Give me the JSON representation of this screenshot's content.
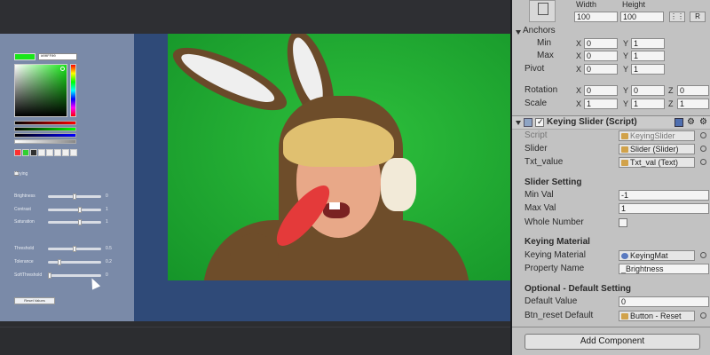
{
  "game_ui": {
    "color_hex": "#00FF00",
    "toggle_label": "Keying",
    "sliders": [
      {
        "name": "Brightness",
        "value": "0",
        "fraction": 0.5
      },
      {
        "name": "Contrast",
        "value": "1",
        "fraction": 0.6
      },
      {
        "name": "Saturation",
        "value": "1",
        "fraction": 0.6
      },
      {
        "name": "Threshold",
        "value": "0.5",
        "fraction": 0.5
      },
      {
        "name": "Tolerance",
        "value": "0.2",
        "fraction": 0.2
      },
      {
        "name": "SoftThreshold",
        "value": "0",
        "fraction": 0.0
      }
    ],
    "reset_label": "Reset Values",
    "preset_colors": [
      "#ff3030",
      "#30d030",
      "#303030",
      "#f0f0f0",
      "#f0f0f0",
      "#f0f0f0",
      "#f0f0f0",
      "#f0f0f0"
    ]
  },
  "inspector": {
    "width_label": "Width",
    "height_label": "Height",
    "width_value": "100",
    "height_value": "100",
    "btn_r": "R",
    "anchors_label": "Anchors",
    "min_label": "Min",
    "max_label": "Max",
    "pivot_label": "Pivot",
    "rotation_label": "Rotation",
    "scale_label": "Scale",
    "anchor_min": {
      "x": "0",
      "y": "1"
    },
    "anchor_max": {
      "x": "0",
      "y": "1"
    },
    "pivot": {
      "x": "0",
      "y": "1"
    },
    "rotation": {
      "x": "0",
      "y": "0",
      "z": "0"
    },
    "scale": {
      "x": "1",
      "y": "1",
      "z": "1"
    },
    "axis_x": "X",
    "axis_y": "Y",
    "axis_z": "Z",
    "component_title": "Keying Slider (Script)",
    "script_label": "Script",
    "script_value": "KeyingSlider",
    "slider_label": "Slider",
    "slider_value": "Slider (Slider)",
    "txt_label": "Txt_value",
    "txt_value": "Txt_val (Text)",
    "slider_setting_header": "Slider Setting",
    "min_val_label": "Min Val",
    "min_val": "-1",
    "max_val_label": "Max Val",
    "max_val": "1",
    "whole_number_label": "Whole Number",
    "keying_material_header": "Keying Material",
    "keying_material_label": "Keying Material",
    "keying_material_value": "KeyingMat",
    "property_name_label": "Property Name",
    "property_name_value": "_Brightness",
    "optional_header": "Optional - Default Setting",
    "default_value_label": "Default Value",
    "default_value": "0",
    "btn_reset_label": "Btn_reset Default",
    "btn_reset_value": "Button - Reset",
    "add_component": "Add Component"
  }
}
